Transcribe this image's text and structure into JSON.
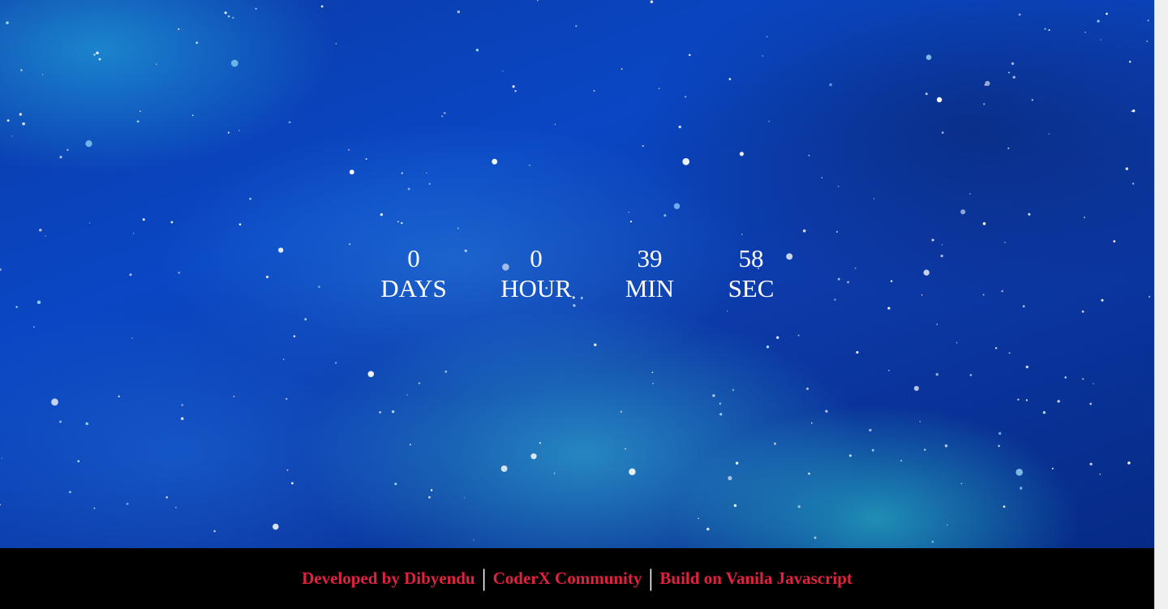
{
  "countdown": {
    "units": [
      {
        "value": "0",
        "label": "DAYS"
      },
      {
        "value": "0",
        "label": "HOUR"
      },
      {
        "value": "39",
        "label": "MIN"
      },
      {
        "value": "58",
        "label": "SEC"
      }
    ]
  },
  "footer": {
    "developer_text": "Developed by Dibyendu",
    "separator": "|",
    "community_text": "CoderX Community",
    "build_text": "Build on Vanila Javascript"
  },
  "colors": {
    "footer_link": "#e0213f",
    "footer_bg": "#000000",
    "countdown_text": "#ffffff"
  }
}
